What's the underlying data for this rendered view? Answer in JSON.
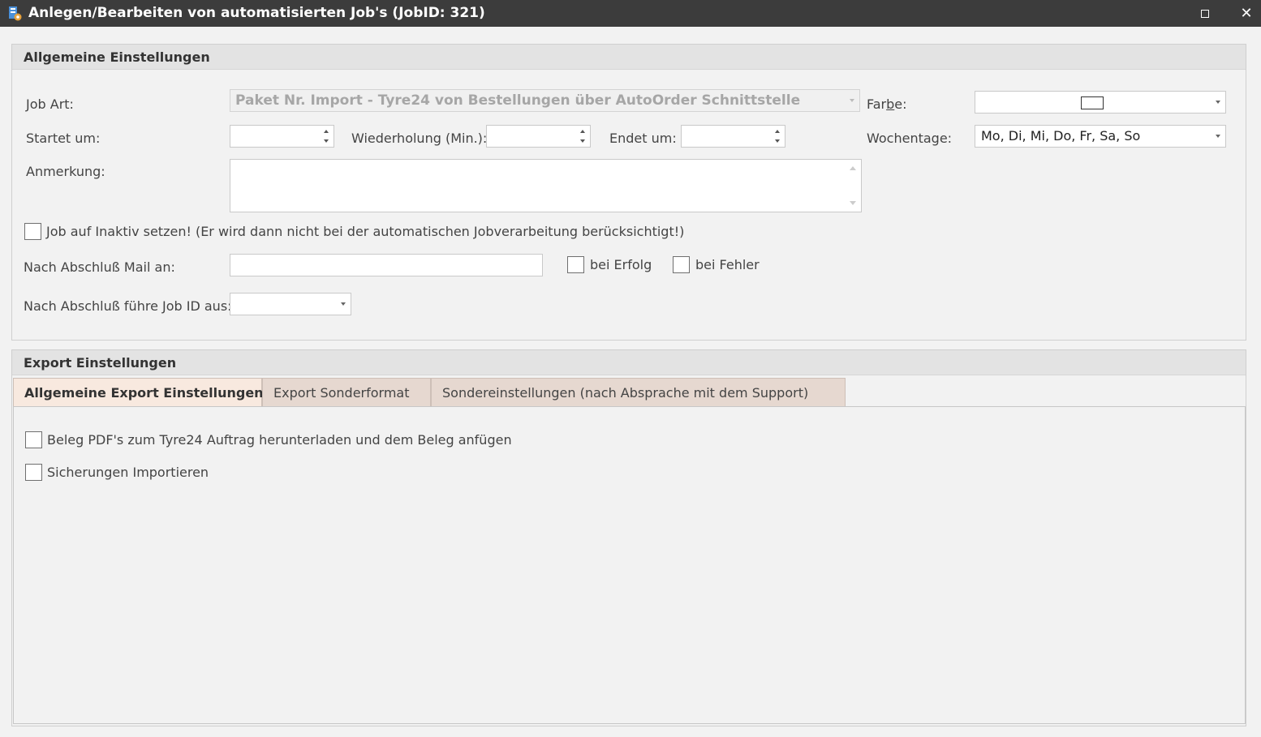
{
  "window": {
    "title": "Anlegen/Bearbeiten von automatisierten Job's (JobID: 321)",
    "maximize_icon": "maximize-icon",
    "close_glyph": "✕"
  },
  "general": {
    "header": "Allgemeine Einstellungen",
    "job_art_label": "Job Art:",
    "job_art_value": "Paket Nr. Import - Tyre24 von Bestellungen über AutoOrder Schnittstelle",
    "farbe_label_pre": "Far",
    "farbe_label_accel": "b",
    "farbe_label_post": "e:",
    "startet_label": "Startet um:",
    "startet_value": "",
    "wiederholung_label": "Wiederholung (Min.):",
    "wiederholung_value": "",
    "endet_label": "Endet um:",
    "endet_value": "",
    "wochentage_label": "Wochentage:",
    "wochentage_value": "Mo, Di, Mi, Do, Fr, Sa, So",
    "anmerkung_label": "Anmerkung:",
    "anmerkung_value": "",
    "inaktiv_label": "Job auf Inaktiv setzen! (Er wird dann nicht bei der automatischen Jobverarbeitung berücksichtigt!)",
    "inaktiv_checked": false,
    "mail_label": "Nach Abschluß Mail an:",
    "mail_value": "",
    "bei_erfolg_label": "bei Erfolg",
    "bei_erfolg_checked": false,
    "bei_fehler_label": "bei Fehler",
    "bei_fehler_checked": false,
    "next_job_label": "Nach Abschluß führe Job ID aus:",
    "next_job_value": ""
  },
  "export": {
    "header": "Export Einstellungen",
    "tabs": [
      {
        "label": "Allgemeine Export Einstellungen",
        "active": true
      },
      {
        "label": "Export Sonderformat",
        "active": false
      },
      {
        "label": "Sondereinstellungen (nach Absprache mit dem Support)",
        "active": false
      }
    ],
    "options": [
      {
        "label": "Beleg PDF's zum Tyre24 Auftrag herunterladen und dem Beleg anfügen",
        "checked": false
      },
      {
        "label": "Sicherungen Importieren",
        "checked": false
      }
    ]
  },
  "colors": {
    "titlebar": "#3c3c3c",
    "tab_active": "#f8e9df",
    "tab_inactive": "#e6d8d0"
  }
}
